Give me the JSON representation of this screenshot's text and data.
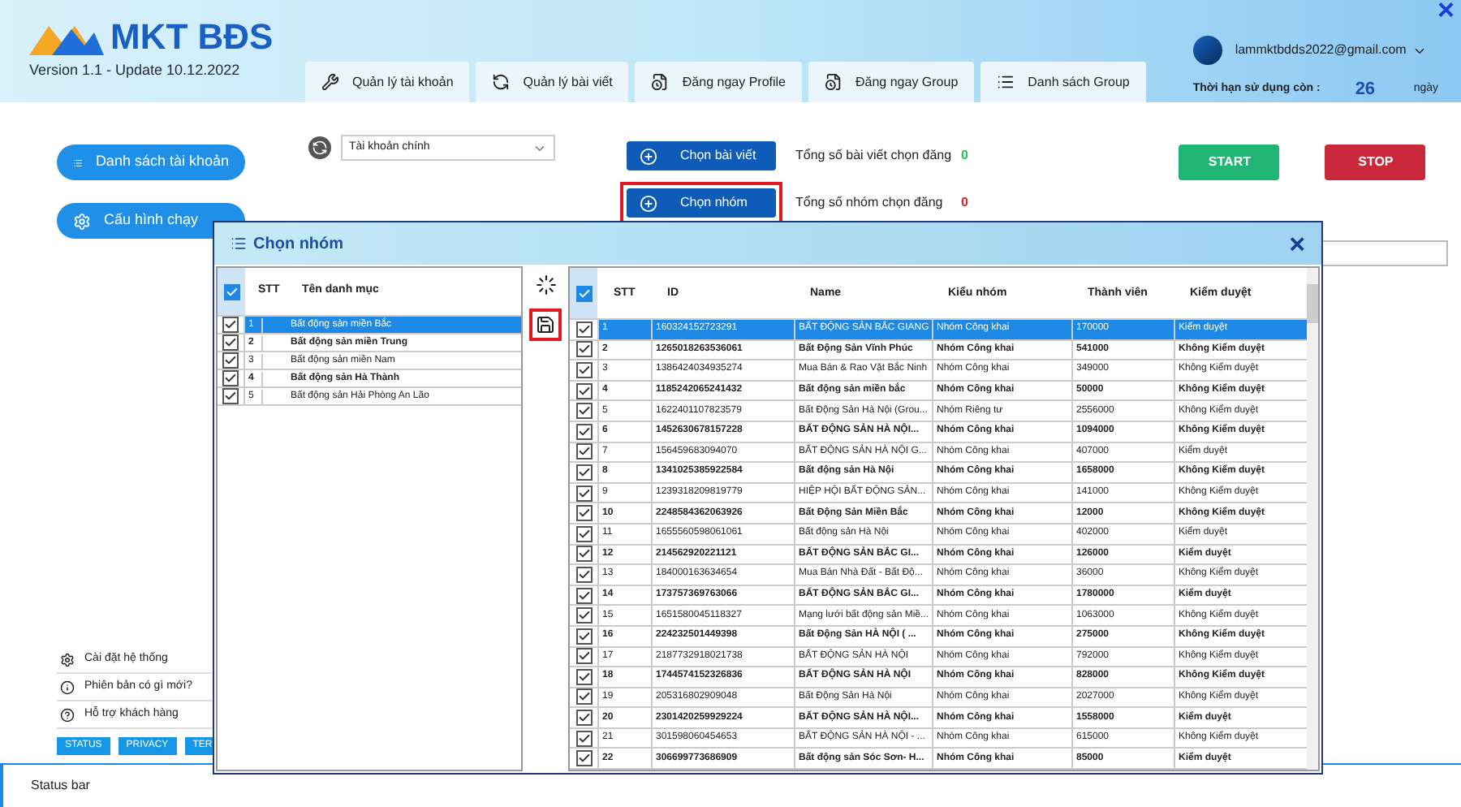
{
  "header": {
    "logo": "MKT BĐS",
    "version": "Version 1.1 - Update 10.12.2022",
    "email": "lammktbdds2022@gmail.com",
    "license_label": "Thời hạn sử dụng còn :",
    "days": "26",
    "days_unit": "ngày",
    "close": "×"
  },
  "tabs": [
    {
      "label": "Quản lý tài khoản",
      "kind": "wrench"
    },
    {
      "label": "Quản lý bài viết",
      "kind": "refresh"
    },
    {
      "label": "Đăng ngay Profile",
      "kind": "file"
    },
    {
      "label": "Đăng ngay Group",
      "kind": "file"
    },
    {
      "label": "Danh sách Group",
      "kind": "list"
    }
  ],
  "toolbar": {
    "account_select": "Tài khoản chính",
    "buttons": [
      {
        "label": "Chọn bài viết",
        "highlighted": false,
        "count_label": "Tổng số bài viết chọn đăng",
        "count": "0",
        "color": "#22c55e"
      },
      {
        "label": "Chọn nhóm",
        "highlighted": true,
        "count_label": "Tổng số nhóm chọn đăng",
        "count": "0",
        "color": "#dc2626"
      }
    ],
    "start": "START",
    "stop": "STOP"
  },
  "sidebar": {
    "buttons": [
      {
        "label": "Danh sách tài khoản",
        "kind": "list"
      },
      {
        "label": "Cấu hình chạy",
        "kind": "gear"
      }
    ],
    "menu": [
      {
        "label": "Cài đặt hệ thống",
        "kind": "gear"
      },
      {
        "label": "Phiên bản có gì mới?",
        "kind": "info"
      },
      {
        "label": "Hỗ trợ khách hàng",
        "kind": "help"
      }
    ],
    "links": [
      "STATUS",
      "PRIVACY",
      "TER"
    ]
  },
  "dialog": {
    "title": "Chọn nhóm",
    "close": "×",
    "categories": {
      "all_checked": true,
      "columns": [
        "STT",
        "Tên danh mục"
      ],
      "rows": [
        {
          "stt": "1",
          "name": "Bất động sản miền Bắc",
          "checked": true,
          "selected": true,
          "bold": false
        },
        {
          "stt": "2",
          "name": "Bất động sản miền Trung",
          "checked": true,
          "selected": false,
          "bold": true
        },
        {
          "stt": "3",
          "name": "Bất động sản miền Nam",
          "checked": true,
          "selected": false,
          "bold": false
        },
        {
          "stt": "4",
          "name": "Bất động sản Hà Thành",
          "checked": true,
          "selected": false,
          "bold": true
        },
        {
          "stt": "5",
          "name": "Bất động sản Hải Phòng An Lão",
          "checked": true,
          "selected": false,
          "bold": false
        }
      ]
    },
    "groups": {
      "all_checked": true,
      "columns": [
        "STT",
        "ID",
        "Name",
        "Kiểu nhóm",
        "Thành viên",
        "Kiểm duyệt"
      ],
      "rows": [
        {
          "cells": [
            "1",
            "160324152723291",
            "BẤT ĐỘNG SẢN BẮC GIANG",
            "Nhóm Công khai",
            "170000",
            "Kiểm duyệt"
          ],
          "checked": true,
          "selected": true,
          "bold": false
        },
        {
          "cells": [
            "2",
            "1265018263536061",
            "Bất Động Sản Vĩnh Phúc",
            "Nhóm Công khai",
            "541000",
            "Không Kiểm duyệt"
          ],
          "checked": true,
          "selected": false,
          "bold": true
        },
        {
          "cells": [
            "3",
            "1386424034935274",
            "Mua Bán & Rao Vặt Bắc Ninh",
            "Nhóm Công khai",
            "349000",
            "Không Kiểm duyệt"
          ],
          "checked": true,
          "selected": false,
          "bold": false
        },
        {
          "cells": [
            "4",
            "1185242065241432",
            "Bất động sản miền bắc",
            "Nhóm Công khai",
            "50000",
            "Không Kiểm duyệt"
          ],
          "checked": true,
          "selected": false,
          "bold": true
        },
        {
          "cells": [
            "5",
            "1622401107823579",
            "Bất Động Sản Hà Nội (Grou...",
            "Nhóm Riêng tư",
            "2556000",
            "Không Kiểm duyệt"
          ],
          "checked": true,
          "selected": false,
          "bold": false
        },
        {
          "cells": [
            "6",
            "1452630678157228",
            "BẤT ĐỘNG SẢN HÀ NỘI...",
            "Nhóm Công khai",
            "1094000",
            "Không Kiểm duyệt"
          ],
          "checked": true,
          "selected": false,
          "bold": true
        },
        {
          "cells": [
            "7",
            "156459683094070",
            "BẤT ĐỘNG SẢN HÀ NỘI G...",
            "Nhóm Công khai",
            "407000",
            "Kiểm duyệt"
          ],
          "checked": true,
          "selected": false,
          "bold": false
        },
        {
          "cells": [
            "8",
            "1341025385922584",
            "Bất động sản Hà Nội",
            "Nhóm Công khai",
            "1658000",
            "Không Kiểm duyệt"
          ],
          "checked": true,
          "selected": false,
          "bold": true
        },
        {
          "cells": [
            "9",
            "1239318209819779",
            "HIỆP HỘI BẤT ĐỘNG SẢN...",
            "Nhóm Công khai",
            "141000",
            "Không Kiểm duyệt"
          ],
          "checked": true,
          "selected": false,
          "bold": false
        },
        {
          "cells": [
            "10",
            "2248584362063926",
            "Bất Động Sản Miền Bắc",
            "Nhóm Công khai",
            "12000",
            "Không Kiểm duyệt"
          ],
          "checked": true,
          "selected": false,
          "bold": true
        },
        {
          "cells": [
            "11",
            "1655560598061061",
            "Bất động sản Hà Nội",
            "Nhóm Công khai",
            "402000",
            "Kiểm duyệt"
          ],
          "checked": true,
          "selected": false,
          "bold": false
        },
        {
          "cells": [
            "12",
            "214562920221121",
            "BẤT ĐỘNG SẢN BẮC GI...",
            "Nhóm Công khai",
            "126000",
            "Kiểm duyệt"
          ],
          "checked": true,
          "selected": false,
          "bold": true
        },
        {
          "cells": [
            "13",
            "184000163634654",
            "Mua Bán Nhà Đất - Bất Độ...",
            "Nhóm Công khai",
            "36000",
            "Không Kiểm duyệt"
          ],
          "checked": true,
          "selected": false,
          "bold": false
        },
        {
          "cells": [
            "14",
            "173757369763066",
            "BẤT ĐỘNG SẢN BẮC GI...",
            "Nhóm Công khai",
            "1780000",
            "Kiểm duyệt"
          ],
          "checked": true,
          "selected": false,
          "bold": true
        },
        {
          "cells": [
            "15",
            "1651580045118327",
            "Mạng lưới bất động sản Miề...",
            "Nhóm Công khai",
            "1063000",
            "Không Kiểm duyệt"
          ],
          "checked": true,
          "selected": false,
          "bold": false
        },
        {
          "cells": [
            "16",
            "224232501449398",
            "Bất Động Sản HÀ NỘI ( ...",
            "Nhóm Công khai",
            "275000",
            "Không Kiểm duyệt"
          ],
          "checked": true,
          "selected": false,
          "bold": true
        },
        {
          "cells": [
            "17",
            "2187732918021738",
            "BẤT ĐỘNG SẢN HÀ NỘI",
            "Nhóm Công khai",
            "792000",
            "Không Kiểm duyệt"
          ],
          "checked": true,
          "selected": false,
          "bold": false
        },
        {
          "cells": [
            "18",
            "1744574152326836",
            "BẤT ĐỘNG SẢN HÀ NỘI",
            "Nhóm Công khai",
            "828000",
            "Không Kiểm duyệt"
          ],
          "checked": true,
          "selected": false,
          "bold": true
        },
        {
          "cells": [
            "19",
            "205316802909048",
            "Bất Động Sản Hà Nội",
            "Nhóm Công khai",
            "2027000",
            "Không Kiểm duyệt"
          ],
          "checked": true,
          "selected": false,
          "bold": false
        },
        {
          "cells": [
            "20",
            "2301420259929224",
            "BẤT ĐỘNG SẢN HÀ NỘI...",
            "Nhóm Công khai",
            "1558000",
            "Kiểm duyệt"
          ],
          "checked": true,
          "selected": false,
          "bold": true
        },
        {
          "cells": [
            "21",
            "301598060454653",
            "BẤT ĐỘNG SẢN HÀ NỘI - ...",
            "Nhóm Công khai",
            "615000",
            "Không Kiểm duyệt"
          ],
          "checked": true,
          "selected": false,
          "bold": false
        },
        {
          "cells": [
            "22",
            "306699773686909",
            "Bất động sản Sóc Sơn- H...",
            "Nhóm Công khai",
            "85000",
            "Kiểm duyệt"
          ],
          "checked": true,
          "selected": false,
          "bold": true
        }
      ]
    }
  },
  "status_bar": "Status bar"
}
